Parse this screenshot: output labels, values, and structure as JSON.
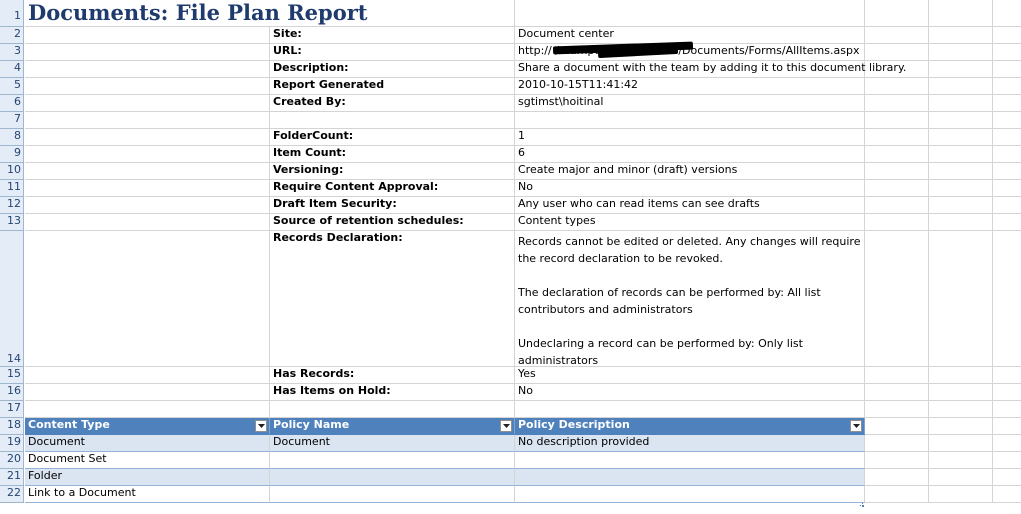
{
  "title": "Documents: File Plan Report",
  "row_numbers": [
    "1",
    "2",
    "3",
    "4",
    "5",
    "6",
    "7",
    "8",
    "9",
    "10",
    "11",
    "12",
    "13",
    "14",
    "15",
    "16",
    "17",
    "18",
    "19",
    "20",
    "21",
    "22"
  ],
  "properties": [
    {
      "label": "Site:",
      "value": "Document center"
    },
    {
      "label": "URL:",
      "value": "http://               /teampoint/doc-center/Documents/Forms/AllItems.aspx"
    },
    {
      "label": "Description:",
      "value": "Share a document with the team by adding it to this document library."
    },
    {
      "label": "Report Generated",
      "value": "2010-10-15T11:41:42"
    },
    {
      "label": "Created By:",
      "value": "sgtimst\\hoitinal"
    },
    {
      "label": "",
      "value": ""
    },
    {
      "label": "FolderCount:",
      "value": "1"
    },
    {
      "label": "Item Count:",
      "value": "6"
    },
    {
      "label": "Versioning:",
      "value": "Create major and minor (draft) versions"
    },
    {
      "label": "Require Content Approval:",
      "value": "No"
    },
    {
      "label": "Draft Item Security:",
      "value": "Any user who can read items can see drafts"
    },
    {
      "label": "Source of retention schedules:",
      "value": "Content types"
    },
    {
      "label": "Records Declaration:",
      "value": "Records cannot be edited or deleted.  Any changes will require\nthe record declaration to be revoked.\n\nThe declaration of records can be performed by: All list\ncontributors and administrators\n\nUndeclaring a record can be performed by: Only list\nadministrators"
    },
    {
      "label": "Has Records:",
      "value": "Yes"
    },
    {
      "label": "Has Items on Hold:",
      "value": "No"
    }
  ],
  "table": {
    "headers": [
      "Content Type",
      "Policy Name",
      "Policy Description"
    ],
    "rows": [
      [
        "Document",
        "Document",
        "No description provided"
      ],
      [
        "Document Set",
        "",
        ""
      ],
      [
        "Folder",
        "",
        ""
      ],
      [
        "Link to a Document",
        "",
        ""
      ]
    ]
  },
  "colors": {
    "header_fill": "#4f81bd",
    "band_fill": "#dbe5f1",
    "title_color": "#1f3a6d",
    "row_header_fill": "#e4ecf7"
  }
}
